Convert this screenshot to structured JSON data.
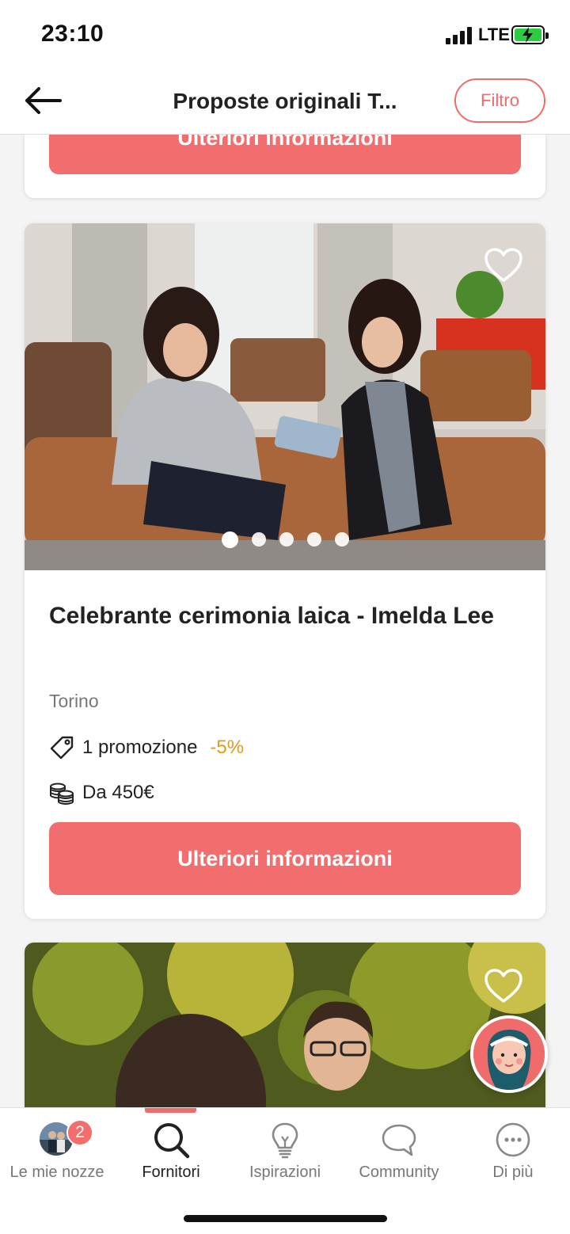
{
  "status_bar": {
    "time": "23:10",
    "network": "LTE"
  },
  "header": {
    "title": "Proposte originali T...",
    "filter_label": "Filtro"
  },
  "cards": [
    {
      "cta_label": "Ulteriori informazioni"
    },
    {
      "title": "Celebrante cerimonia laica - Imelda Lee",
      "location": "Torino",
      "promo_text": "1 promozione",
      "discount": "-5%",
      "price": "Da 450€",
      "cta_label": "Ulteriori informazioni",
      "photo_count": 5,
      "active_photo_index": 0
    },
    {
      "title": ""
    }
  ],
  "bottom_nav": {
    "items": [
      {
        "label": "Le mie nozze",
        "icon": "avatar",
        "badge": "2"
      },
      {
        "label": "Fornitori",
        "icon": "search-icon",
        "active": true
      },
      {
        "label": "Ispirazioni",
        "icon": "lightbulb-icon"
      },
      {
        "label": "Community",
        "icon": "chat-bubble-icon"
      },
      {
        "label": "Di più",
        "icon": "more-icon"
      }
    ]
  },
  "colors": {
    "accent": "#f26d6d",
    "discount": "#e29a1a"
  }
}
